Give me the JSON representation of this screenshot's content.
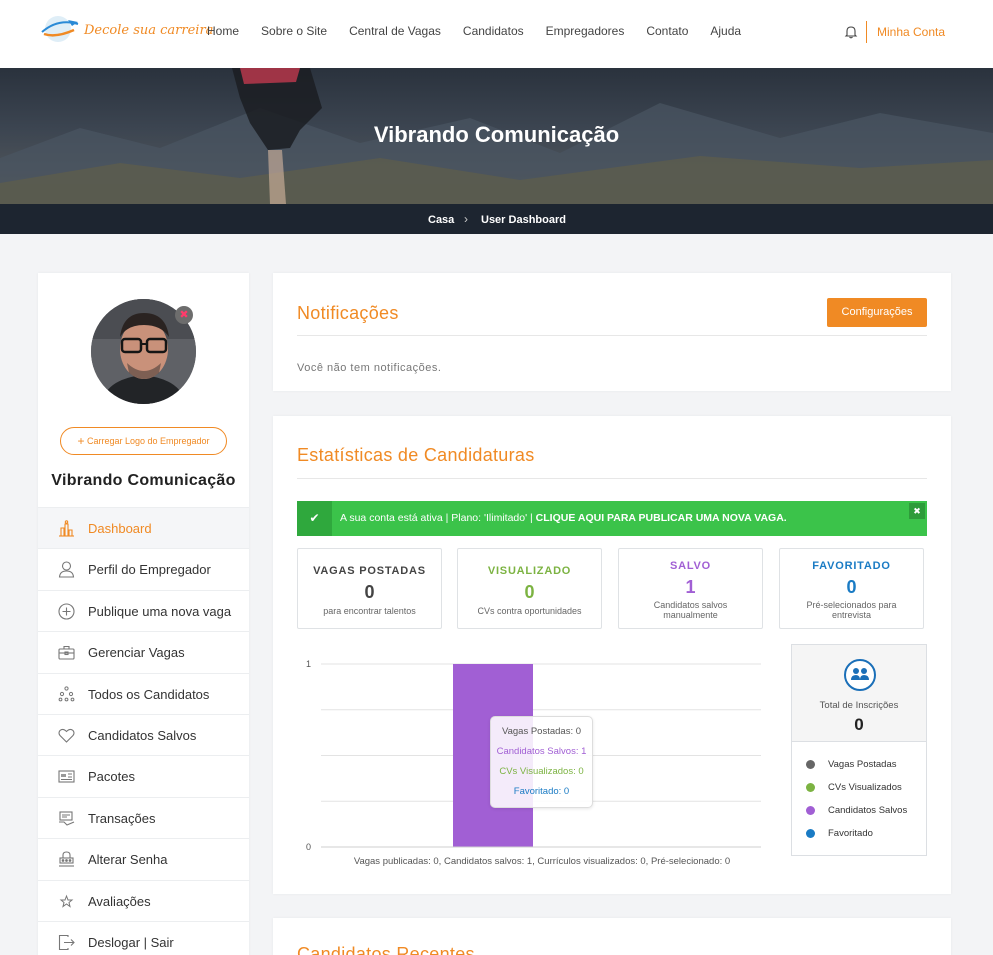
{
  "header": {
    "logo_text": "Decole sua carreira",
    "nav": [
      "Home",
      "Sobre o Site",
      "Central de Vagas",
      "Candidatos",
      "Empregadores",
      "Contato",
      "Ajuda"
    ],
    "account": "Minha Conta"
  },
  "hero": {
    "title": "Vibrando Comunicação",
    "breadcrumb": [
      "Casa",
      "User Dashboard"
    ]
  },
  "sidebar": {
    "upload_logo_label": "Carregar Logo do Empregador",
    "company": "Vibrando Comunicação",
    "items": [
      {
        "label": "Dashboard",
        "icon": "dashboard-icon",
        "active": true
      },
      {
        "label": "Perfil do Empregador",
        "icon": "user-icon"
      },
      {
        "label": "Publique uma nova vaga",
        "icon": "plus-circle-icon"
      },
      {
        "label": "Gerenciar Vagas",
        "icon": "briefcase-icon"
      },
      {
        "label": "Todos os Candidatos",
        "icon": "people-icon"
      },
      {
        "label": "Candidatos Salvos",
        "icon": "heart-icon"
      },
      {
        "label": "Pacotes",
        "icon": "package-icon"
      },
      {
        "label": "Transações",
        "icon": "transactions-icon"
      },
      {
        "label": "Alterar Senha",
        "icon": "password-icon"
      },
      {
        "label": "Avaliações",
        "icon": "star-icon"
      },
      {
        "label": "Deslogar | Sair",
        "icon": "logout-icon"
      }
    ]
  },
  "notifications": {
    "title": "Notificações",
    "settings_button": "Configurações",
    "empty_text": "Você não tem notificações."
  },
  "stats": {
    "title": "Estatísticas de Candidaturas",
    "alert_text": "A sua conta está ativa | Plano: 'Ilimitado' |",
    "alert_link": "CLIQUE AQUI PARA PUBLICAR UMA NOVA VAGA.",
    "cards": [
      {
        "label": "VAGAS POSTADAS",
        "value": "0",
        "sub": "para encontrar talentos",
        "color": "#444444"
      },
      {
        "label": "VISUALIZADO",
        "value": "0",
        "sub": "CVs contra oportunidades",
        "color": "#7cb342"
      },
      {
        "label": "SALVO",
        "value": "1",
        "sub": "Candidatos salvos manualmente",
        "color": "#a15fd4"
      },
      {
        "label": "FAVORITADO",
        "value": "0",
        "sub": "Pré-selecionados para entrevista",
        "color": "#1a7bc4"
      }
    ],
    "total_label": "Total de Inscrições",
    "total_value": "0"
  },
  "chart_data": {
    "type": "bar",
    "categories": [
      ""
    ],
    "series": [
      {
        "name": "Vagas Postadas",
        "color": "#666666",
        "values": [
          0
        ]
      },
      {
        "name": "CVs Visualizados",
        "color": "#7cb342",
        "values": [
          0
        ]
      },
      {
        "name": "Candidatos Salvos",
        "color": "#a15fd4",
        "values": [
          1
        ]
      },
      {
        "name": "Favoritado",
        "color": "#1a7bc4",
        "values": [
          0
        ]
      }
    ],
    "ylim": [
      0,
      1
    ],
    "y_ticks": [
      "0",
      "1"
    ],
    "tooltip": [
      "Vagas Postadas: 0",
      "Candidatos Salvos: 1",
      "CVs Visualizados: 0",
      "Favoritado: 0"
    ],
    "caption": "Vagas publicadas: 0, Candidatos salvos: 1, Currículos visualizados: 0, Pré-selecionado: 0",
    "legend": [
      "Vagas Postadas",
      "CVs Visualizados",
      "Candidatos Salvos",
      "Favoritado"
    ]
  },
  "next_section_title": "Candidatos Recentes"
}
